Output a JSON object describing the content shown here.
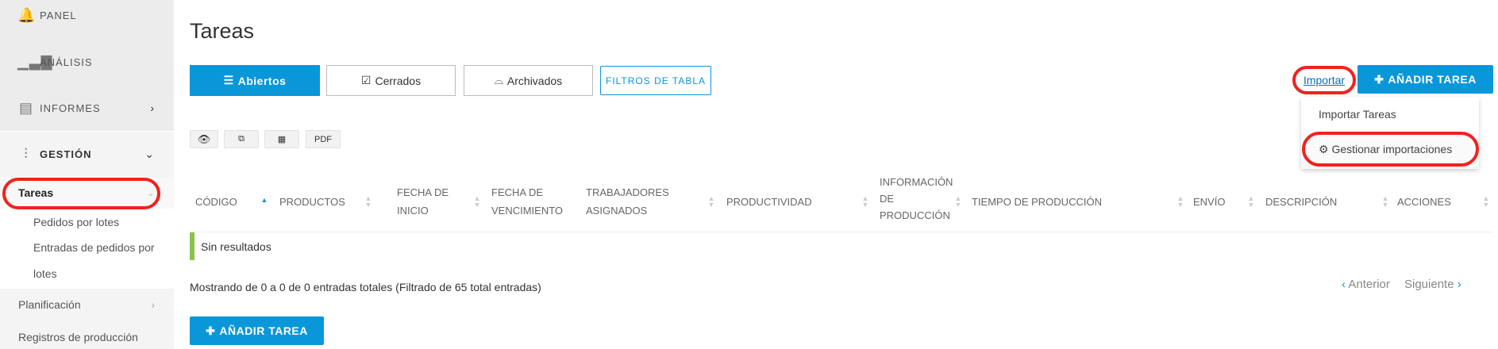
{
  "sidebar": {
    "panel": "PANEL",
    "analisis": "ANÁLISIS",
    "informes": "INFORMES",
    "gestion": "GESTIÓN",
    "tareas": "Tareas",
    "sub": [
      "Pedidos por lotes",
      "Entradas de pedidos por",
      "lotes"
    ],
    "planificacion": "Planificación",
    "registros": "Registros de producción"
  },
  "page": {
    "title": "Tareas"
  },
  "tabs": {
    "abiertos": "Abiertos",
    "cerrados": "Cerrados",
    "archivados": "Archivados",
    "filtros": "FILTROS DE TABLA"
  },
  "actions": {
    "importar": "Importar",
    "add": "AÑADIR TAREA",
    "add_bottom": "AÑADIR TAREA"
  },
  "dropdown": {
    "item1": "Importar Tareas",
    "item2": "Gestionar importaciones"
  },
  "export": {
    "pdf": "PDF"
  },
  "table": {
    "headers": {
      "codigo": "CÓDIGO",
      "productos": "PRODUCTOS",
      "fi1": "FECHA DE",
      "fi2": "INICIO",
      "fv1": "FECHA DE",
      "fv2": "VENCIMIENTO",
      "tr1": "TRABAJADORES",
      "tr2": "ASIGNADOS",
      "productividad": "PRODUCTIVIDAD",
      "in1": "INFORMACIÓN",
      "in2": "DE",
      "in3": "PRODUCCIÓN",
      "tiempo": "TIEMPO DE PRODUCCIÓN",
      "envio": "ENVÍO",
      "descripcion": "DESCRIPCIÓN",
      "acciones": "ACCIONES"
    },
    "empty": "Sin resultados",
    "info": "Mostrando de 0 a 0 de 0 entradas totales (Filtrado de 65 total entradas)"
  },
  "pagination": {
    "prev": "Anterior",
    "next": "Siguiente"
  },
  "colors": {
    "accent": "#0a97d9",
    "highlight": "#f0221e",
    "empty_bar": "#8bc34a"
  }
}
